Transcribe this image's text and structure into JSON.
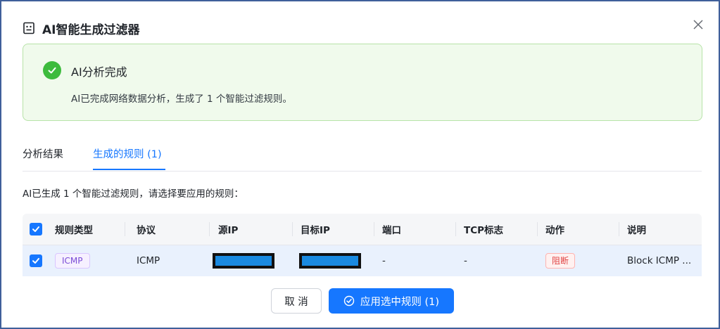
{
  "dialog": {
    "title": "AI智能生成过滤器",
    "title_icon": "robot-icon",
    "close_icon": "close-icon"
  },
  "alert": {
    "icon": "check-circle-icon",
    "title": "AI分析完成",
    "description": "AI已完成网络数据分析，生成了 1 个智能过滤规则。"
  },
  "tabs": [
    {
      "label": "分析结果",
      "active": false
    },
    {
      "label": "生成的规则 (1)",
      "active": true
    }
  ],
  "hint": "AI已生成 1 个智能过滤规则，请选择要应用的规则：",
  "table": {
    "columns": [
      "规则类型",
      "协议",
      "源IP",
      "目标IP",
      "端口",
      "TCP标志",
      "动作",
      "说明"
    ],
    "rows": [
      {
        "selected": true,
        "rule_type": "ICMP",
        "protocol": "ICMP",
        "src_ip": "",
        "dst_ip": "",
        "port": "-",
        "tcp_flags": "-",
        "action": "阻断",
        "description": "Block ICMP ..."
      }
    ]
  },
  "footer": {
    "cancel_label": "取 消",
    "apply_label": "应用选中规则 (1)",
    "apply_icon": "check-circle-outline-icon"
  },
  "colors": {
    "primary": "#1677ff",
    "success": "#3dbb3d",
    "success_bg": "#f0faec",
    "danger": "#e04545",
    "tag_purple": "#7a4bd6"
  }
}
